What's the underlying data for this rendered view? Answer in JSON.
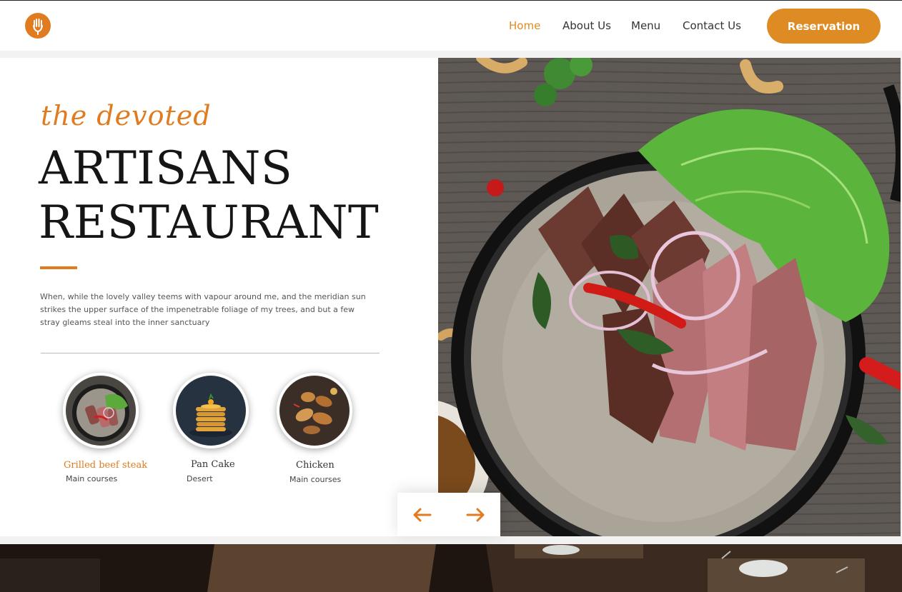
{
  "header": {
    "logo_icon": "hand-fork-icon",
    "nav": [
      {
        "label": "Home",
        "active": true
      },
      {
        "label": "About Us",
        "active": false
      },
      {
        "label": "Menu",
        "active": false
      },
      {
        "label": "Contact Us",
        "active": false
      }
    ],
    "reservation_label": "Reservation"
  },
  "hero": {
    "tagline": "the devoted",
    "title_line1": "ARTISANS",
    "title_line2": "RESTAURANT",
    "description": "When, while the lovely valley teems with vapour around me, and the meridian sun strikes the upper surface of the impenetrable foliage of my trees, and but a few stray gleams steal into the inner sanctuary",
    "dishes": [
      {
        "name": "Grilled beef steak",
        "category": "Main courses",
        "active": true
      },
      {
        "name": "Pan Cake",
        "category": "Desert",
        "active": false
      },
      {
        "name": "Chicken",
        "category": "Main courses",
        "active": false
      }
    ],
    "prev_icon": "arrow-left-icon",
    "next_icon": "arrow-right-icon"
  },
  "colors": {
    "accent": "#e07b1f",
    "button": "#de8b23",
    "text_dark": "#151515"
  }
}
